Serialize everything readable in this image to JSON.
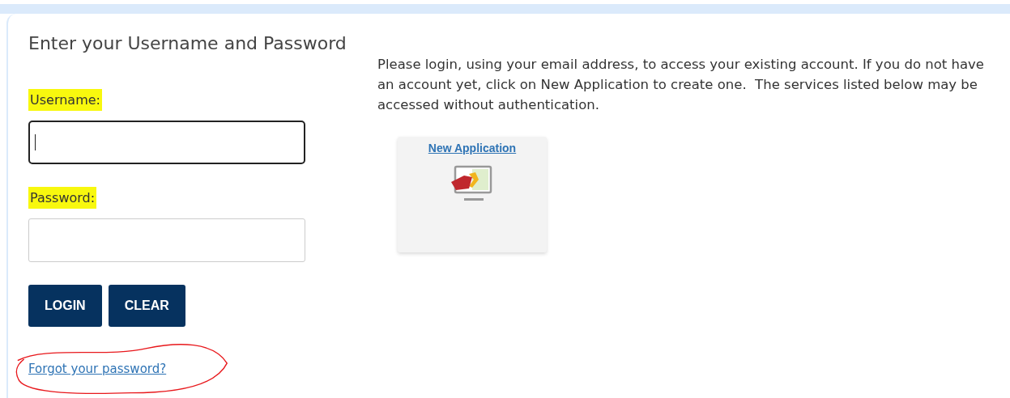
{
  "login": {
    "title": "Enter your Username and Password",
    "fields": [
      {
        "label": "Username:",
        "highlighted": true,
        "focused": true
      },
      {
        "label": "Password:",
        "highlighted": true,
        "focused": false
      }
    ],
    "buttons": [
      "LOGIN",
      "CLEAR"
    ],
    "forgot_link": {
      "text": "Forgot your password?",
      "circled": true
    }
  },
  "info": {
    "text": "Please login, using your email address, to access your existing account. If you do not have an account yet, click on New Application to create one.  The services listed below may be accessed without authentication."
  },
  "services": [
    {
      "label": "New Application"
    }
  ]
}
